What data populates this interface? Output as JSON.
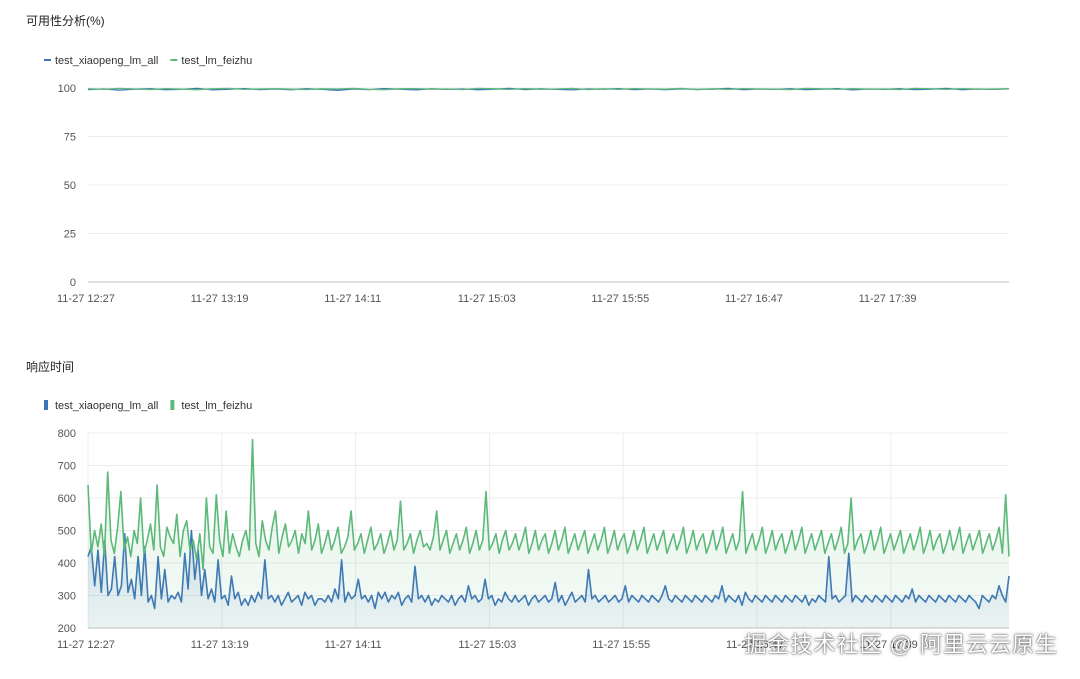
{
  "colors": {
    "series_blue": "#3d73b8",
    "series_green": "#5db97a",
    "grid": "#ececec",
    "axis": "#bfbfbf"
  },
  "watermark": "掘金技术社区 @ 阿里云云原生",
  "chart_data": [
    {
      "type": "line",
      "title": "可用性分析(%)",
      "legend": "top-left",
      "grid": true,
      "ylim": [
        0,
        100
      ],
      "yticks": [
        0,
        25,
        50,
        75,
        100
      ],
      "xtick_labels": [
        "11-27 12:27",
        "11-27 13:19",
        "11-27 14:11",
        "11-27 15:03",
        "11-27 15:55",
        "11-27 16:47",
        "11-27 17:39"
      ],
      "series": [
        {
          "name": "test_xiaopeng_lm_all",
          "color": "#3d73b8",
          "values": [
            99.2,
            99.5,
            98.9,
            99.4,
            99.6,
            99.1,
            99.3,
            99.8,
            99.0,
            99.4,
            99.7,
            99.2,
            99.5,
            99.1,
            99.6,
            99.3,
            98.8,
            99.5,
            99.2,
            99.7,
            99.4,
            99.0,
            99.6,
            99.3,
            99.5,
            99.1,
            99.4,
            99.8,
            99.2,
            99.6,
            99.3,
            99.0,
            99.5,
            99.4,
            99.7,
            99.2,
            99.5,
            99.1,
            99.6,
            99.3,
            99.4,
            99.8,
            99.1,
            99.5,
            99.3,
            99.6,
            99.2,
            99.4,
            99.7,
            99.0,
            99.5,
            99.3,
            99.6,
            99.2,
            99.4,
            99.8,
            99.1,
            99.5,
            99.3,
            99.6
          ]
        },
        {
          "name": "test_lm_feizhu",
          "color": "#5db97a",
          "values": [
            99.6,
            99.3,
            99.8,
            99.5,
            99.2,
            99.7,
            99.4,
            99.1,
            99.6,
            99.8,
            99.3,
            99.5,
            99.7,
            99.4,
            99.2,
            99.6,
            99.5,
            99.8,
            99.3,
            99.1,
            99.6,
            99.7,
            99.4,
            99.5,
            99.2,
            99.8,
            99.6,
            99.3,
            99.7,
            99.4,
            99.5,
            99.8,
            99.2,
            99.6,
            99.3,
            99.7,
            99.5,
            99.4,
            99.8,
            99.1,
            99.6,
            99.3,
            99.7,
            99.5,
            99.4,
            99.2,
            99.8,
            99.6,
            99.3,
            99.7,
            99.4,
            99.5,
            99.2,
            99.8,
            99.6,
            99.3,
            99.7,
            99.4,
            99.5,
            99.6
          ]
        }
      ]
    },
    {
      "type": "area",
      "title": "响应时间",
      "legend": "top-left",
      "grid": true,
      "ylim": [
        200,
        800
      ],
      "yticks": [
        200,
        300,
        400,
        500,
        600,
        700,
        800
      ],
      "xtick_labels": [
        "11-27 12:27",
        "11-27 13:19",
        "11-27 14:11",
        "11-27 15:03",
        "11-27 15:55",
        "11-27 16:47",
        "11-27 17:39"
      ],
      "series": [
        {
          "name": "test_xiaopeng_lm_all",
          "color": "#3d73b8",
          "values": [
            420,
            450,
            330,
            440,
            310,
            470,
            300,
            320,
            420,
            300,
            330,
            490,
            310,
            350,
            290,
            420,
            300,
            450,
            280,
            300,
            260,
            420,
            290,
            380,
            280,
            300,
            290,
            310,
            280,
            430,
            320,
            500,
            350,
            440,
            300,
            380,
            290,
            320,
            280,
            410,
            290,
            300,
            270,
            360,
            290,
            310,
            270,
            290,
            270,
            300,
            280,
            310,
            290,
            410,
            290,
            300,
            280,
            300,
            270,
            290,
            310,
            280,
            290,
            300,
            270,
            310,
            290,
            300,
            270,
            290,
            290,
            280,
            300,
            280,
            320,
            290,
            410,
            280,
            310,
            290,
            300,
            350,
            290,
            300,
            280,
            300,
            260,
            310,
            290,
            310,
            280,
            300,
            290,
            310,
            270,
            290,
            300,
            280,
            390,
            290,
            300,
            280,
            300,
            270,
            290,
            280,
            300,
            290,
            280,
            300,
            270,
            290,
            300,
            280,
            330,
            290,
            300,
            280,
            290,
            350,
            290,
            300,
            270,
            290,
            280,
            310,
            290,
            280,
            300,
            280,
            290,
            300,
            270,
            290,
            300,
            280,
            290,
            300,
            280,
            290,
            340,
            280,
            300,
            270,
            290,
            310,
            280,
            290,
            300,
            280,
            380,
            290,
            300,
            280,
            290,
            300,
            280,
            290,
            300,
            280,
            290,
            330,
            280,
            300,
            290,
            280,
            300,
            290,
            280,
            300,
            290,
            280,
            300,
            330,
            290,
            280,
            300,
            290,
            280,
            300,
            290,
            280,
            300,
            290,
            280,
            300,
            290,
            280,
            300,
            290,
            330,
            280,
            300,
            290,
            280,
            300,
            270,
            310,
            290,
            280,
            300,
            290,
            280,
            300,
            290,
            280,
            300,
            290,
            280,
            300,
            290,
            280,
            300,
            290,
            280,
            300,
            270,
            290,
            280,
            300,
            290,
            280,
            420,
            290,
            300,
            280,
            290,
            300,
            430,
            280,
            300,
            290,
            280,
            300,
            290,
            280,
            300,
            290,
            280,
            300,
            290,
            280,
            300,
            290,
            280,
            300,
            290,
            320,
            280,
            300,
            290,
            280,
            300,
            290,
            280,
            300,
            290,
            280,
            300,
            290,
            280,
            300,
            290,
            280,
            300,
            290,
            280,
            260,
            300,
            290,
            280,
            300,
            290,
            330,
            300,
            280,
            360
          ]
        },
        {
          "name": "test_lm_feizhu",
          "color": "#5db97a",
          "values": [
            640,
            430,
            500,
            450,
            520,
            420,
            680,
            470,
            430,
            510,
            620,
            440,
            480,
            420,
            500,
            460,
            600,
            430,
            470,
            520,
            440,
            640,
            450,
            420,
            510,
            480,
            460,
            550,
            420,
            500,
            530,
            440,
            470,
            410,
            490,
            380,
            600,
            450,
            430,
            610,
            470,
            420,
            560,
            430,
            490,
            450,
            420,
            470,
            500,
            440,
            780,
            460,
            420,
            530,
            470,
            440,
            510,
            560,
            430,
            480,
            520,
            450,
            470,
            500,
            430,
            490,
            460,
            560,
            440,
            470,
            520,
            430,
            460,
            500,
            440,
            470,
            510,
            430,
            450,
            480,
            560,
            440,
            460,
            490,
            430,
            470,
            510,
            440,
            460,
            490,
            430,
            460,
            500,
            440,
            470,
            590,
            440,
            460,
            490,
            430,
            470,
            500,
            450,
            460,
            440,
            480,
            560,
            440,
            470,
            500,
            430,
            460,
            490,
            440,
            470,
            510,
            430,
            460,
            500,
            440,
            470,
            620,
            440,
            460,
            490,
            430,
            470,
            500,
            440,
            460,
            490,
            440,
            470,
            510,
            430,
            460,
            500,
            440,
            470,
            490,
            430,
            460,
            500,
            440,
            470,
            510,
            430,
            460,
            490,
            440,
            470,
            500,
            430,
            460,
            490,
            440,
            470,
            510,
            430,
            460,
            500,
            440,
            470,
            490,
            430,
            460,
            500,
            440,
            470,
            510,
            430,
            460,
            490,
            440,
            470,
            500,
            430,
            460,
            490,
            440,
            470,
            510,
            430,
            460,
            500,
            440,
            470,
            490,
            430,
            460,
            500,
            440,
            470,
            510,
            430,
            460,
            490,
            440,
            470,
            620,
            430,
            460,
            490,
            440,
            470,
            510,
            430,
            460,
            500,
            440,
            470,
            490,
            430,
            460,
            500,
            440,
            470,
            510,
            430,
            460,
            490,
            440,
            470,
            500,
            430,
            460,
            490,
            440,
            470,
            510,
            430,
            460,
            600,
            440,
            470,
            490,
            430,
            460,
            500,
            440,
            470,
            510,
            430,
            460,
            490,
            440,
            470,
            500,
            430,
            460,
            490,
            440,
            470,
            510,
            430,
            460,
            500,
            440,
            470,
            490,
            430,
            460,
            500,
            440,
            470,
            510,
            430,
            460,
            490,
            440,
            470,
            500,
            430,
            460,
            490,
            440,
            470,
            510,
            430,
            610,
            420
          ]
        }
      ]
    }
  ]
}
